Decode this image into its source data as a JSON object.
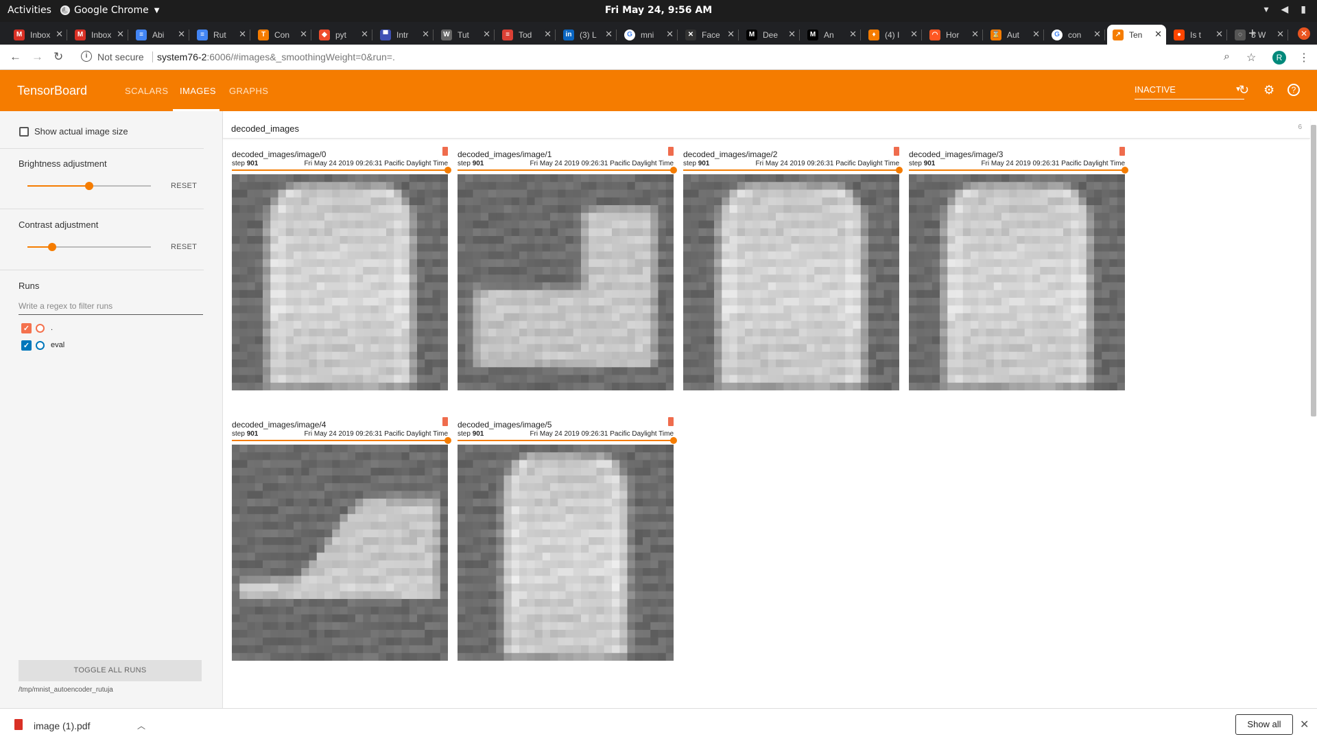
{
  "os": {
    "activities": "Activities",
    "app_name": "Google Chrome",
    "clock": "Fri May 24,  9:56 AM"
  },
  "browser": {
    "tabs": [
      {
        "title": "Inbox",
        "icon": "gmail-icon",
        "color": "#d93025",
        "glyph": "M"
      },
      {
        "title": "Inbox",
        "icon": "gmail-icon",
        "color": "#d93025",
        "glyph": "M"
      },
      {
        "title": "Abi",
        "icon": "docs-icon",
        "color": "#4285f4",
        "glyph": "≡"
      },
      {
        "title": "Rut",
        "icon": "docs-icon",
        "color": "#4285f4",
        "glyph": "≡"
      },
      {
        "title": "Con",
        "icon": "tensorflow-icon",
        "color": "#f57c00",
        "glyph": "T"
      },
      {
        "title": "pyt",
        "icon": "pytorch-icon",
        "color": "#ee4c2c",
        "glyph": "◆"
      },
      {
        "title": "Intr",
        "icon": "site-icon",
        "color": "#3f51b5",
        "glyph": "▀"
      },
      {
        "title": "Tut",
        "icon": "site-icon",
        "color": "#666666",
        "glyph": "W"
      },
      {
        "title": "Tod",
        "icon": "todoist-icon",
        "color": "#db4035",
        "glyph": "≡"
      },
      {
        "title": "(3) L",
        "icon": "linkedin-icon",
        "color": "#0a66c2",
        "glyph": "in"
      },
      {
        "title": "mni",
        "icon": "google-icon",
        "color": "#ffffff",
        "glyph": "G"
      },
      {
        "title": "Face",
        "icon": "site-icon",
        "color": "#333333",
        "glyph": "✕"
      },
      {
        "title": "Dee",
        "icon": "medium-icon",
        "color": "#000000",
        "glyph": "M"
      },
      {
        "title": "An",
        "icon": "medium-icon",
        "color": "#000000",
        "glyph": "M"
      },
      {
        "title": "(4) I",
        "icon": "site-icon",
        "color": "#f57c00",
        "glyph": "♦"
      },
      {
        "title": "Hor",
        "icon": "site-icon",
        "color": "#ff5722",
        "glyph": "◠"
      },
      {
        "title": "Aut",
        "icon": "site-icon",
        "color": "#f57c00",
        "glyph": "⌛"
      },
      {
        "title": "con",
        "icon": "google-icon",
        "color": "#ffffff",
        "glyph": "G"
      },
      {
        "title": "Ten",
        "icon": "tensorboard-icon",
        "color": "#f57c00",
        "glyph": "↗",
        "active": true
      },
      {
        "title": "Is t",
        "icon": "reddit-icon",
        "color": "#ff4500",
        "glyph": "●"
      },
      {
        "title": "5 W",
        "icon": "loading-icon",
        "color": "#555555",
        "glyph": "◌"
      }
    ],
    "security_status": "Not secure",
    "url_host": "system76-2",
    "url_rest": ":6006/#images&_smoothingWeight=0&run=.",
    "profile_initial": "R"
  },
  "tensorboard": {
    "brand": "TensorBoard",
    "nav": [
      "SCALARS",
      "IMAGES",
      "GRAPHS"
    ],
    "active_nav": "IMAGES",
    "status_select": "INACTIVE",
    "accent_color": "#f57c00"
  },
  "sidebar": {
    "show_actual_size": "Show actual image size",
    "brightness_label": "Brightness adjustment",
    "brightness_value": 0.5,
    "contrast_label": "Contrast adjustment",
    "contrast_value": 0.2,
    "reset": "RESET",
    "runs_label": "Runs",
    "filter_placeholder": "Write a regex to filter runs",
    "runs": [
      {
        "name": ".",
        "color": "#f4714d"
      },
      {
        "name": "eval",
        "color": "#0077bb"
      }
    ],
    "toggle_all": "TOGGLE ALL RUNS",
    "logdir": "/tmp/mnist_autoencoder_rutuja"
  },
  "main": {
    "group_title": "decoded_images",
    "group_count": "6",
    "cards": [
      {
        "title": "decoded_images/image/0",
        "step_label": "step",
        "step": "901",
        "wall_time": "Fri May 24 2019 09:26:31 Pacific Daylight Time",
        "shape": "shirt"
      },
      {
        "title": "decoded_images/image/1",
        "step_label": "step",
        "step": "901",
        "wall_time": "Fri May 24 2019 09:26:31 Pacific Daylight Time",
        "shape": "boot"
      },
      {
        "title": "decoded_images/image/2",
        "step_label": "step",
        "step": "901",
        "wall_time": "Fri May 24 2019 09:26:31 Pacific Daylight Time",
        "shape": "shirt"
      },
      {
        "title": "decoded_images/image/3",
        "step_label": "step",
        "step": "901",
        "wall_time": "Fri May 24 2019 09:26:31 Pacific Daylight Time",
        "shape": "shirt"
      },
      {
        "title": "decoded_images/image/4",
        "step_label": "step",
        "step": "901",
        "wall_time": "Fri May 24 2019 09:26:31 Pacific Daylight Time",
        "shape": "sneaker"
      },
      {
        "title": "decoded_images/image/5",
        "step_label": "step",
        "step": "901",
        "wall_time": "Fri May 24 2019 09:26:31 Pacific Daylight Time",
        "shape": "shirt-narrow"
      }
    ]
  },
  "downloads": {
    "file": "image (1).pdf",
    "show_all": "Show all"
  }
}
